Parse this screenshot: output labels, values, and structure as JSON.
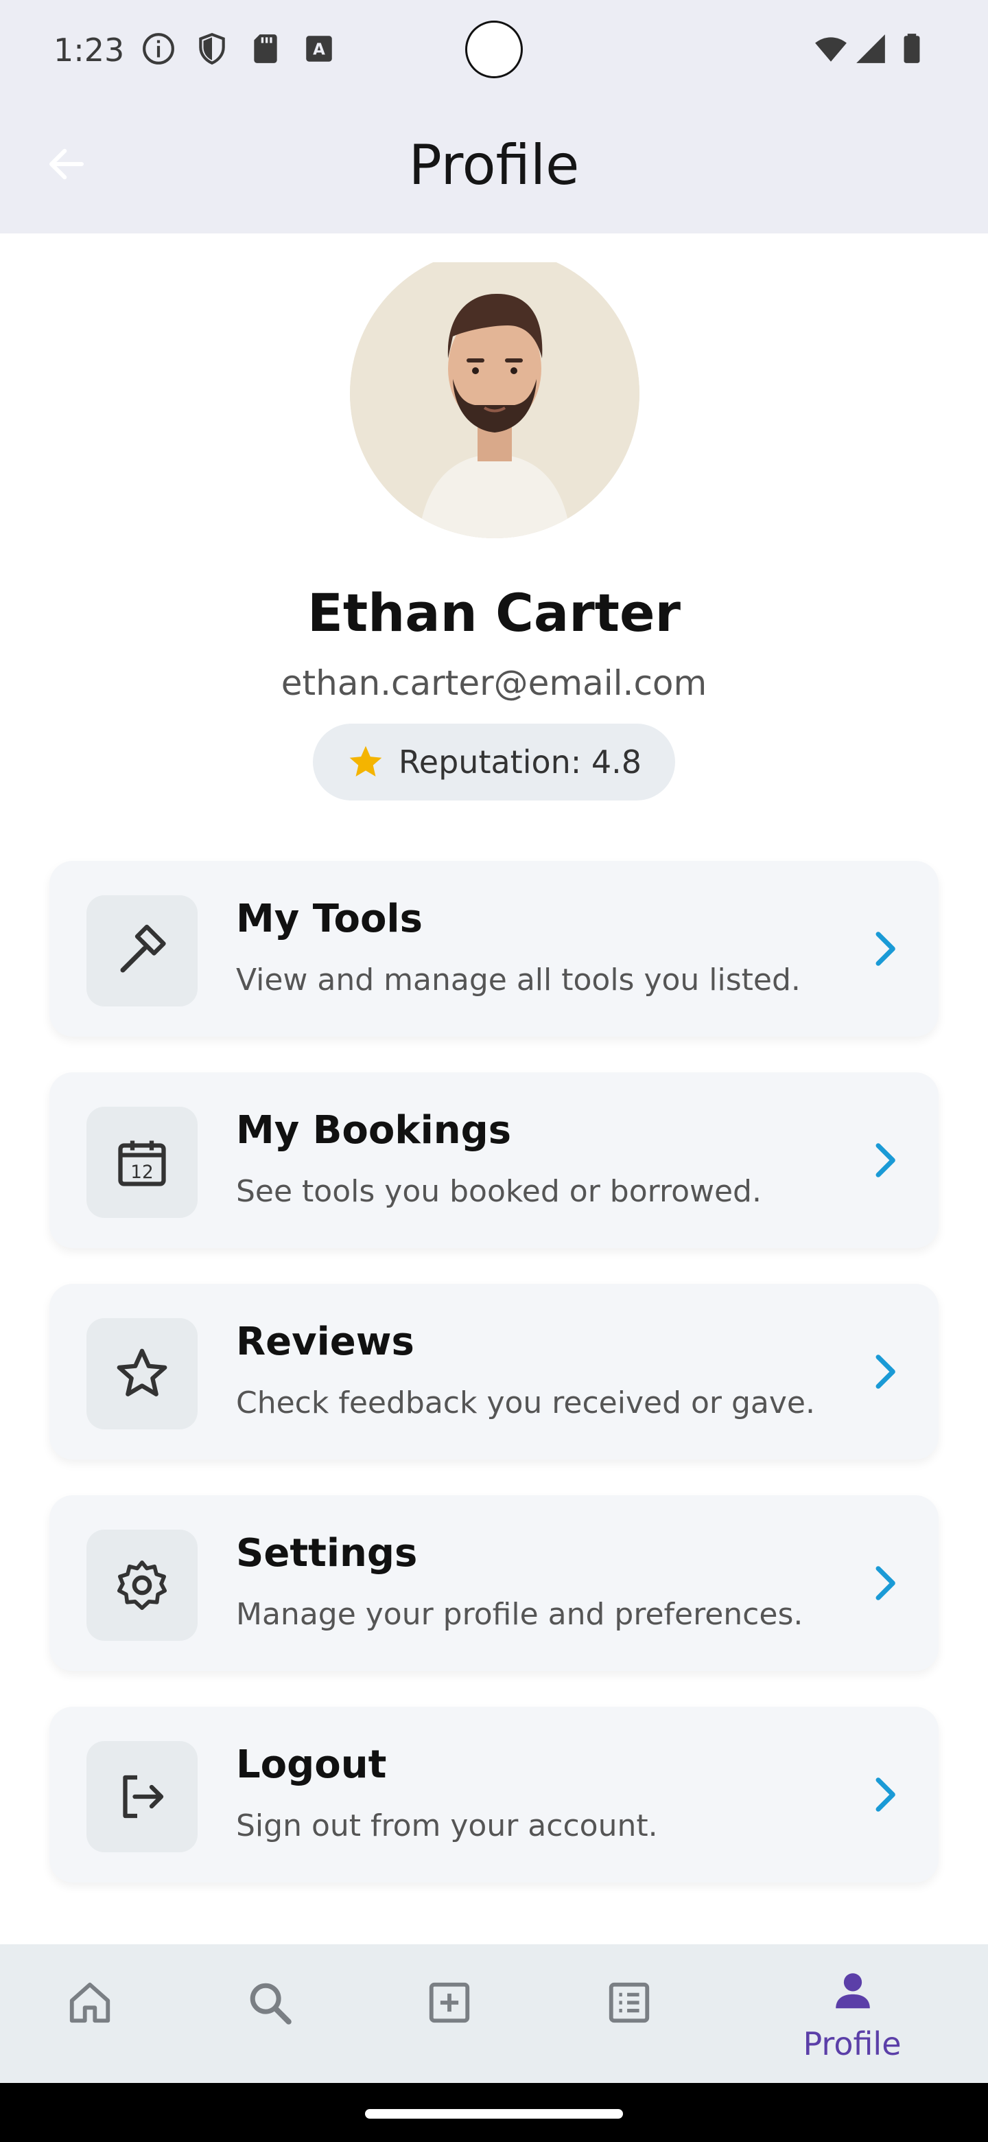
{
  "status_bar": {
    "time": "1:23",
    "left_icons": [
      "info-icon",
      "shield-icon",
      "sd-card-icon",
      "keyboard-a-icon"
    ],
    "right_icons": [
      "wifi-icon",
      "signal-icon",
      "battery-icon"
    ]
  },
  "app_bar": {
    "title": "Profile",
    "back_icon": "arrow-back-icon"
  },
  "profile": {
    "name": "Ethan Carter",
    "email": "ethan.carter@email.com",
    "reputation_label": "Reputation: 4.8",
    "reputation_icon": "star-icon",
    "reputation_icon_color": "#f4b400"
  },
  "menu": [
    {
      "icon": "hammer-icon",
      "title": "My Tools",
      "subtitle": "View and manage all tools you listed."
    },
    {
      "icon": "calendar-icon",
      "title": "My Bookings",
      "subtitle": "See tools you booked or borrowed."
    },
    {
      "icon": "star-outline-icon",
      "title": "Reviews",
      "subtitle": "Check feedback you received or gave."
    },
    {
      "icon": "gear-icon",
      "title": "Settings",
      "subtitle": "Manage your profile and preferences."
    },
    {
      "icon": "logout-icon",
      "title": "Logout",
      "subtitle": "Sign out from your account."
    }
  ],
  "bottom_nav": {
    "items": [
      {
        "icon": "home-icon"
      },
      {
        "icon": "search-icon"
      },
      {
        "icon": "add-box-icon"
      },
      {
        "icon": "list-icon"
      },
      {
        "icon": "person-icon",
        "label": "Profile",
        "active": true
      }
    ],
    "active_color": "#5b3fa8"
  },
  "colors": {
    "accent_chevron": "#1a9ad6",
    "app_bar_bg": "#ecedf4",
    "card_bg": "#f4f6f9"
  }
}
